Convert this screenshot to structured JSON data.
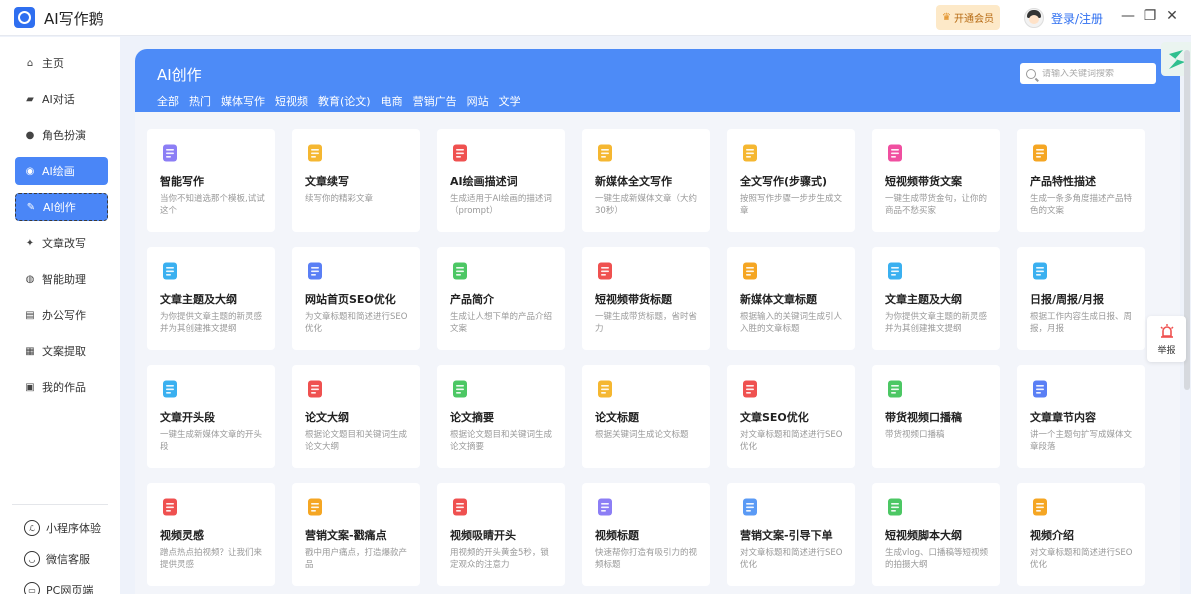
{
  "window": {
    "title": "AI写作鹅",
    "vip_label": "开通会员",
    "login_label": "登录/注册",
    "controls": {
      "minimize": "—",
      "restore": "❐",
      "close": "✕"
    }
  },
  "sidebar": {
    "items": [
      {
        "label": "主页",
        "icon": "home-icon"
      },
      {
        "label": "AI对话",
        "icon": "chat-icon"
      },
      {
        "label": "角色扮演",
        "icon": "mask-icon"
      },
      {
        "label": "AI绘画",
        "icon": "palette-icon"
      },
      {
        "label": "AI创作",
        "icon": "edit-icon"
      },
      {
        "label": "文章改写",
        "icon": "bulb-icon"
      },
      {
        "label": "智能助理",
        "icon": "assistant-icon"
      },
      {
        "label": "办公写作",
        "icon": "office-icon"
      },
      {
        "label": "文案提取",
        "icon": "extract-icon"
      },
      {
        "label": "我的作品",
        "icon": "folder-icon"
      }
    ],
    "bottom_links": [
      {
        "label": "小程序体验",
        "icon": "miniprogram-icon"
      },
      {
        "label": "微信客服",
        "icon": "wechat-icon"
      },
      {
        "label": "PC网页端",
        "icon": "pc-icon"
      }
    ]
  },
  "banner": {
    "title": "AI创作",
    "search_placeholder": "请输入关键词搜索",
    "tabs": [
      "全部",
      "热门",
      "媒体写作",
      "短视频",
      "教育(论文)",
      "电商",
      "营销广告",
      "网站",
      "文学"
    ]
  },
  "cards": [
    {
      "title": "智能写作",
      "desc": "当你不知道选那个模板,试试这个",
      "icon_color": "#8c7ef5"
    },
    {
      "title": "文章续写",
      "desc": "续写你的精彩文章",
      "icon_color": "#f5b731"
    },
    {
      "title": "AI绘画描述词",
      "desc": "生成适用于AI绘画的描述词（prompt）",
      "icon_color": "#ef5150"
    },
    {
      "title": "新媒体全文写作",
      "desc": "一键生成新媒体文章（大约30秒）",
      "icon_color": "#f5b731"
    },
    {
      "title": "全文写作(步骤式)",
      "desc": "按照写作步骤一步步生成文章",
      "icon_color": "#f5b731"
    },
    {
      "title": "短视频带货文案",
      "desc": "一键生成带货金句，让你的商品不愁买家",
      "icon_color": "#f04fa0"
    },
    {
      "title": "产品特性描述",
      "desc": "生成一条多角度描述产品特色的文案",
      "icon_color": "#f5a623"
    },
    {
      "title": "文章主题及大纲",
      "desc": "为你提供文章主题的新灵感 并为其创建推文提纲",
      "icon_color": "#3ab0f0"
    },
    {
      "title": "网站首页SEO优化",
      "desc": "为文章标题和简述进行SEO优化",
      "icon_color": "#5a7ff5"
    },
    {
      "title": "产品简介",
      "desc": "生成让人想下单的产品介绍文案",
      "icon_color": "#4cc764"
    },
    {
      "title": "短视频带货标题",
      "desc": "一键生成带货标题，省时省力",
      "icon_color": "#ef5150"
    },
    {
      "title": "新媒体文章标题",
      "desc": "根据输入的关键词生成引人入胜的文章标题",
      "icon_color": "#f5a623"
    },
    {
      "title": "文章主题及大纲",
      "desc": "为你提供文章主题的新灵感并为其创建推文提纲",
      "icon_color": "#3ab0f0"
    },
    {
      "title": "日报/周报/月报",
      "desc": "根据工作内容生成日报、周报，月报",
      "icon_color": "#3ab0f0"
    },
    {
      "title": "文章开头段",
      "desc": "一键生成新媒体文章的开头段",
      "icon_color": "#3ab0f0"
    },
    {
      "title": "论文大纲",
      "desc": "根据论文题目和关键词生成论文大纲",
      "icon_color": "#ef5150"
    },
    {
      "title": "论文摘要",
      "desc": "根据论文题目和关键词生成论文摘要",
      "icon_color": "#4cc764"
    },
    {
      "title": "论文标题",
      "desc": "根据关键词生成论文标题",
      "icon_color": "#f5b731"
    },
    {
      "title": "文章SEO优化",
      "desc": "对文章标题和简述进行SEO优化",
      "icon_color": "#ef5150"
    },
    {
      "title": "带货视频口播稿",
      "desc": "带货视频口播稿",
      "icon_color": "#4cc764"
    },
    {
      "title": "文章章节内容",
      "desc": "讲一个主题句扩写成媒体文章段落",
      "icon_color": "#5a7ff5"
    },
    {
      "title": "视频灵感",
      "desc": "蹭点热点拍视频？让我们来提供灵感",
      "icon_color": "#ef5150"
    },
    {
      "title": "营销文案-戳痛点",
      "desc": "戳中用户痛点，打造爆款产品",
      "icon_color": "#f5a623"
    },
    {
      "title": "视频吸睛开头",
      "desc": "用视频的开头黄金5秒，锁定观众的注意力",
      "icon_color": "#ef5150"
    },
    {
      "title": "视频标题",
      "desc": "快速帮你打造有吸引力的视频标题",
      "icon_color": "#8c7ef5"
    },
    {
      "title": "营销文案-引导下单",
      "desc": "对文章标题和简述进行SEO优化",
      "icon_color": "#5a9af5"
    },
    {
      "title": "短视频脚本大纲",
      "desc": "生成vlog、口播稿等短视频的拍摄大纲",
      "icon_color": "#4cc764"
    },
    {
      "title": "视频介绍",
      "desc": "对文章标题和简述进行SEO优化",
      "icon_color": "#f5a623"
    }
  ],
  "report": {
    "label": "举报"
  },
  "colors": {
    "accent": "#4a86f7",
    "banner": "#4d8bf7",
    "vip_bg": "#fde9c8"
  }
}
